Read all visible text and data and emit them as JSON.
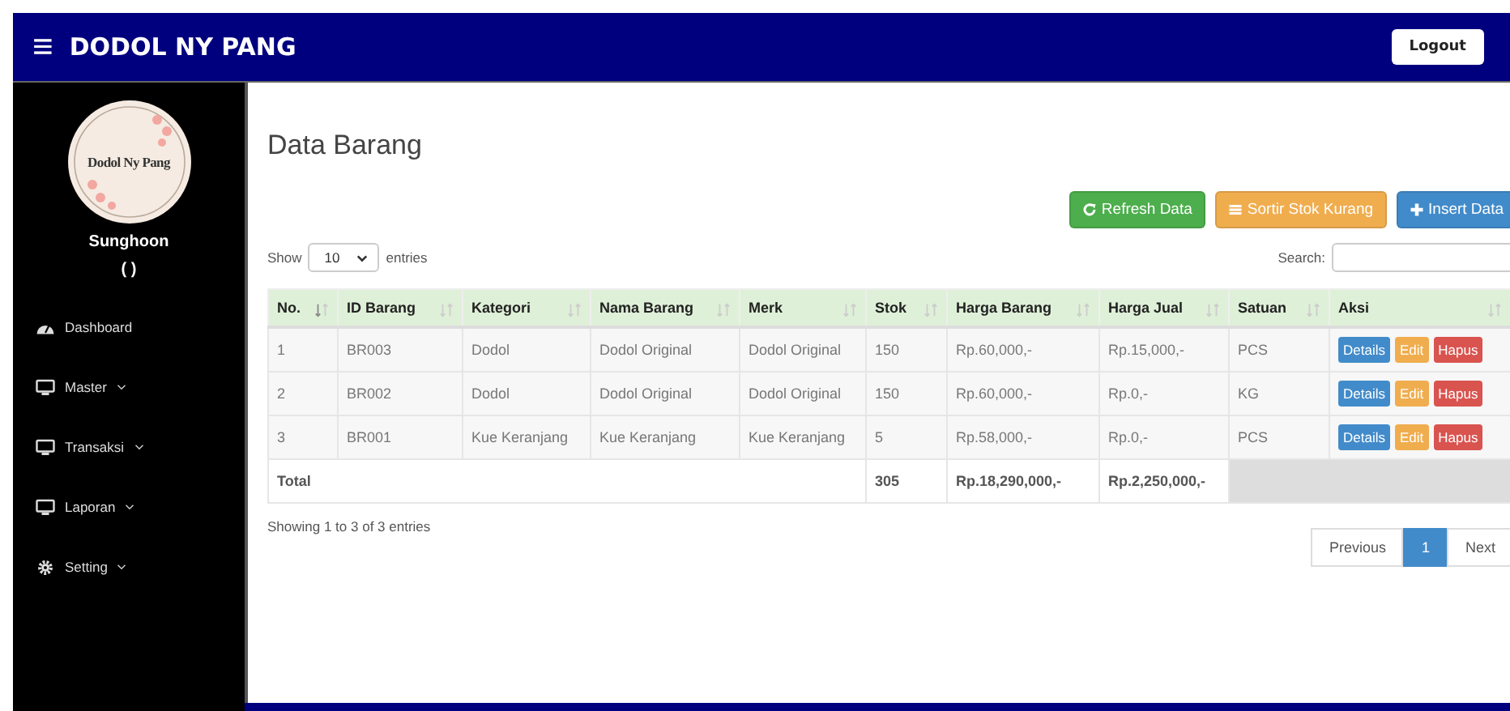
{
  "navbar": {
    "menu_icon": "≡",
    "brand": "DODOL NY PANG",
    "logout": "Logout"
  },
  "sidebar": {
    "logo_text": "Dodol Ny Pang",
    "user_name": "Sunghoon",
    "user_role": "( )",
    "items": [
      {
        "label": "Dashboard",
        "kind": "link"
      },
      {
        "label": "Master",
        "kind": "menu"
      },
      {
        "label": "Transaksi",
        "kind": "menu"
      },
      {
        "label": "Laporan",
        "kind": "menu"
      },
      {
        "label": "Setting",
        "kind": "menu"
      }
    ]
  },
  "page_title": "Data Barang",
  "actions": [
    {
      "label": "Refresh Data",
      "kind": "refresh"
    },
    {
      "label": "Sortir Stok Kurang",
      "kind": "list"
    },
    {
      "label": "Insert Data",
      "kind": "plus"
    }
  ],
  "length": {
    "show": "Show",
    "value": "10",
    "entries": "entries"
  },
  "search": {
    "label": "Search:"
  },
  "table": {
    "columns": [
      {
        "label": "No.",
        "sorted": true
      },
      {
        "label": "ID Barang",
        "sorted": false
      },
      {
        "label": "Kategori",
        "sorted": false
      },
      {
        "label": "Nama Barang",
        "sorted": false
      },
      {
        "label": "Merk",
        "sorted": false
      },
      {
        "label": "Stok",
        "sorted": false
      },
      {
        "label": "Harga Barang",
        "sorted": false
      },
      {
        "label": "Harga Jual",
        "sorted": false
      },
      {
        "label": "Satuan",
        "sorted": false
      },
      {
        "label": "Aksi",
        "sorted": false
      }
    ],
    "rows": [
      {
        "cells": [
          "1",
          "BR003",
          "Dodol",
          "Dodol Original",
          "Dodol Original",
          "150",
          "Rp.60,000,-",
          "Rp.15,000,-",
          "PCS"
        ],
        "buttons": [
          "Details",
          "Edit",
          "Hapus"
        ]
      },
      {
        "cells": [
          "2",
          "BR002",
          "Dodol",
          "Dodol Original",
          "Dodol Original",
          "150",
          "Rp.60,000,-",
          "Rp.0,-",
          "KG"
        ],
        "buttons": [
          "Details",
          "Edit",
          "Hapus"
        ]
      },
      {
        "cells": [
          "3",
          "BR001",
          "Kue Keranjang",
          "Kue Keranjang",
          "Kue Keranjang",
          "5",
          "Rp.58,000,-",
          "Rp.0,-",
          "PCS"
        ],
        "buttons": [
          "Details",
          "Edit",
          "Hapus"
        ]
      }
    ],
    "total": {
      "label": "Total",
      "stok": "305",
      "harga_barang": "Rp.18,290,000,-",
      "harga_jual": "Rp.2,250,000,-"
    }
  },
  "info": "Showing 1 to 3 of 3 entries",
  "pagination": [
    {
      "label": "Previous",
      "selected": false
    },
    {
      "label": "1",
      "selected": true
    },
    {
      "label": "Next",
      "selected": false
    }
  ]
}
